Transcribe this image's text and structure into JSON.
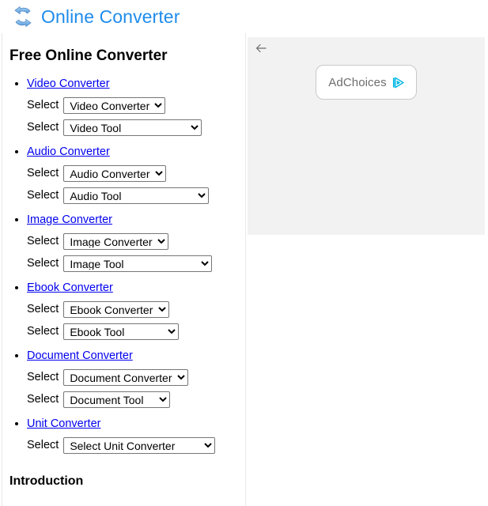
{
  "header": {
    "logo_icon": "refresh-arrows-icon",
    "title": "Online Converter",
    "title_color": "#1f8ceb"
  },
  "main": {
    "page_title": "Free Online Converter",
    "link_color": "#0000ee",
    "select_label": "Select",
    "categories": [
      {
        "link": "Video Converter",
        "selects": [
          {
            "value": "Video Converter",
            "options": [
              "Video Converter"
            ]
          },
          {
            "value": "Video Tool",
            "options": [
              "Video Tool"
            ]
          }
        ]
      },
      {
        "link": "Audio Converter",
        "selects": [
          {
            "value": "Audio Converter",
            "options": [
              "Audio Converter"
            ]
          },
          {
            "value": "Audio Tool",
            "options": [
              "Audio Tool"
            ]
          }
        ]
      },
      {
        "link": "Image Converter",
        "selects": [
          {
            "value": "Image Converter",
            "options": [
              "Image Converter"
            ]
          },
          {
            "value": "Image Tool",
            "options": [
              "Image Tool"
            ]
          }
        ]
      },
      {
        "link": "Ebook Converter",
        "selects": [
          {
            "value": "Ebook Converter",
            "options": [
              "Ebook Converter"
            ]
          },
          {
            "value": "Ebook Tool",
            "options": [
              "Ebook Tool"
            ]
          }
        ]
      },
      {
        "link": "Document Converter",
        "selects": [
          {
            "value": "Document Converter",
            "options": [
              "Document Converter"
            ]
          },
          {
            "value": "Document Tool",
            "options": [
              "Document Tool"
            ]
          }
        ]
      },
      {
        "link": "Unit Converter",
        "selects": [
          {
            "value": "Select Unit Converter",
            "options": [
              "Select Unit Converter"
            ]
          }
        ]
      }
    ],
    "section_heading": "Introduction"
  },
  "ad": {
    "back_arrow_icon": "arrow-left-icon",
    "adchoices_label": "AdChoices",
    "adchoices_icon": "adchoices-triangle-icon",
    "adchoices_icon_color": "#00b8e6",
    "background_color": "#f2f2f2"
  }
}
